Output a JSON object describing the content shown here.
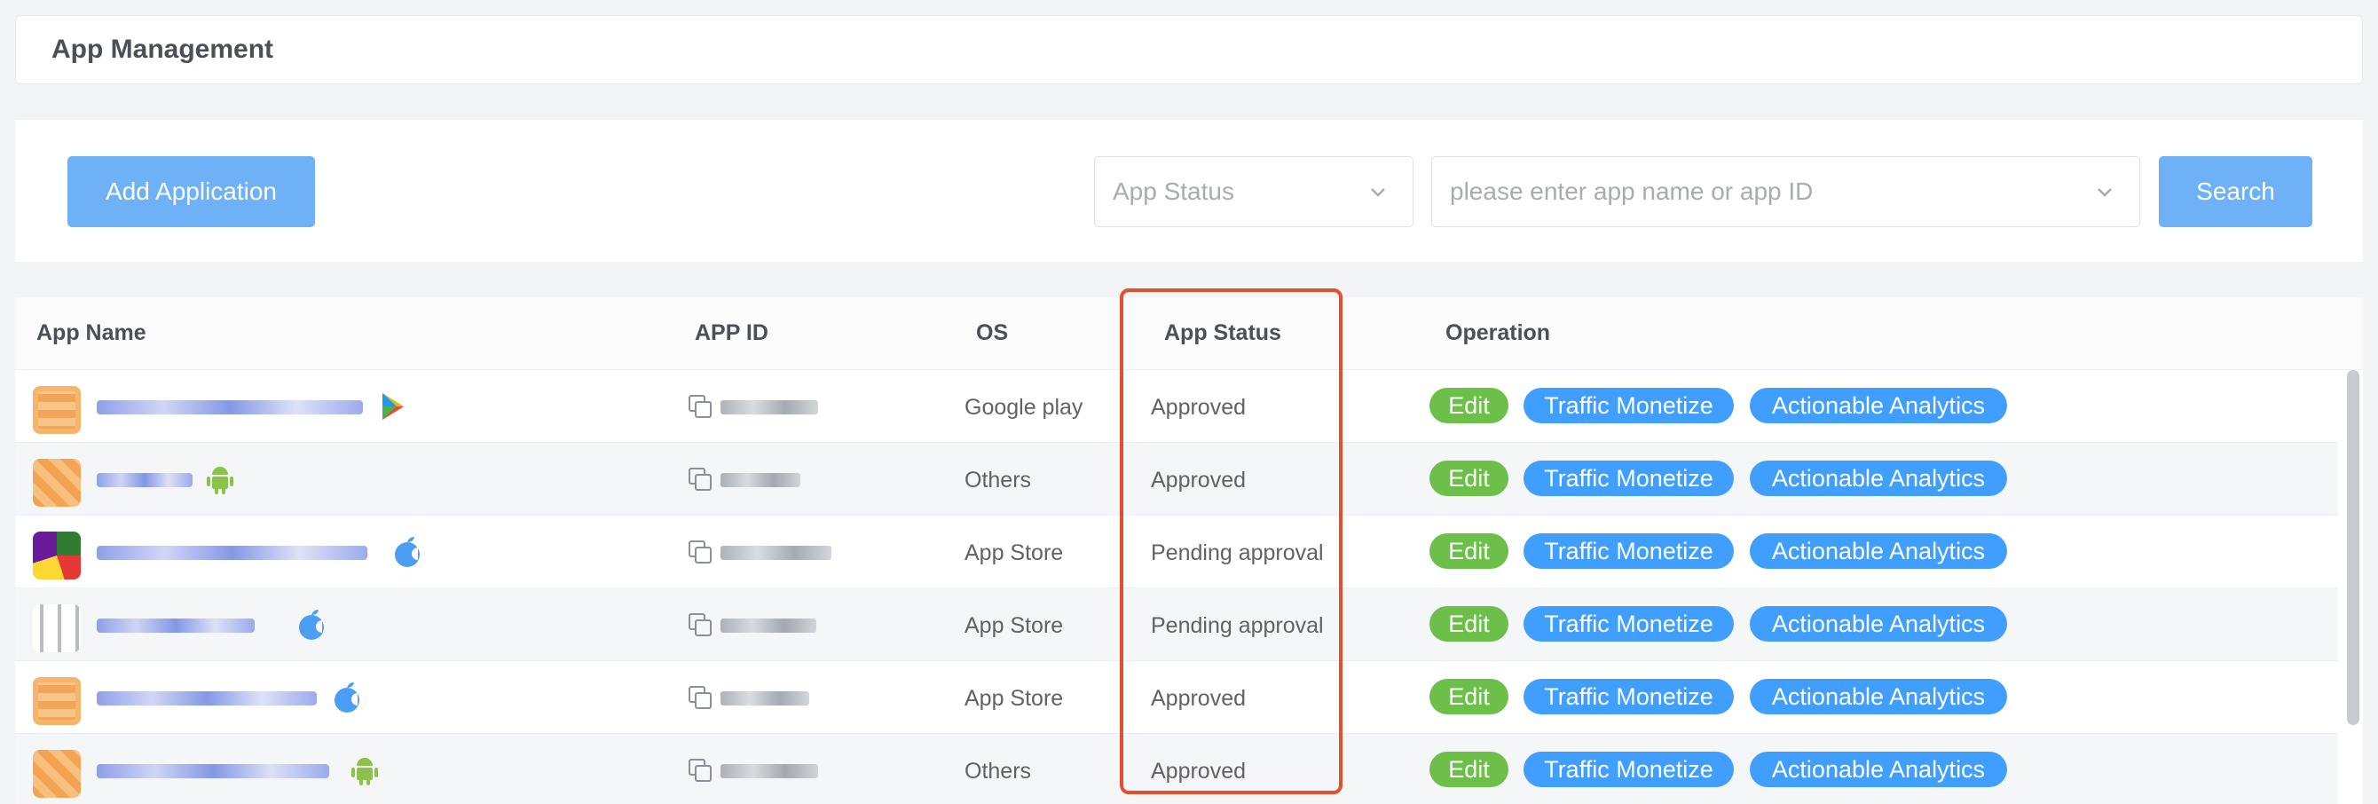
{
  "header": {
    "title": "App Management"
  },
  "toolbar": {
    "add_label": "Add Application",
    "status_placeholder": "App Status",
    "search_placeholder": "please enter app name or app ID",
    "search_label": "Search"
  },
  "table": {
    "columns": {
      "app_name": "App Name",
      "app_id": "APP ID",
      "os": "OS",
      "app_status": "App Status",
      "operation": "Operation"
    },
    "rows": [
      {
        "os": "Google play",
        "status": "Approved",
        "edit": "Edit",
        "traffic": "Traffic Monetize",
        "analytics": "Actionable Analytics"
      },
      {
        "os": "Others",
        "status": "Approved",
        "edit": "Edit",
        "traffic": "Traffic Monetize",
        "analytics": "Actionable Analytics"
      },
      {
        "os": "App Store",
        "status": "Pending approval",
        "edit": "Edit",
        "traffic": "Traffic Monetize",
        "analytics": "Actionable Analytics"
      },
      {
        "os": "App Store",
        "status": "Pending approval",
        "edit": "Edit",
        "traffic": "Traffic Monetize",
        "analytics": "Actionable Analytics"
      },
      {
        "os": "App Store",
        "status": "Approved",
        "edit": "Edit",
        "traffic": "Traffic Monetize",
        "analytics": "Actionable Analytics"
      },
      {
        "os": "Others",
        "status": "Approved",
        "edit": "Edit",
        "traffic": "Traffic Monetize",
        "analytics": "Actionable Analytics"
      }
    ]
  },
  "colors": {
    "primary": "#409eff",
    "button_light": "#6fb1f7",
    "edit_green": "#6cc04a",
    "highlight_red": "#e4502f"
  }
}
